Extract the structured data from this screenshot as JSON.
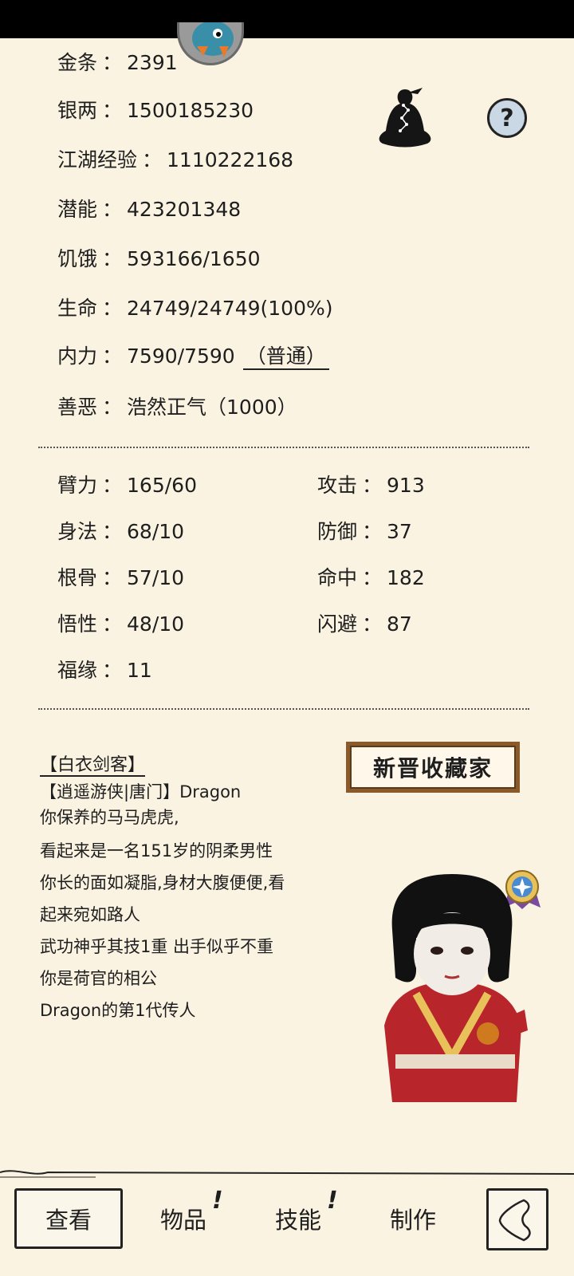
{
  "stats": {
    "gold": {
      "label": "金条",
      "value": "2391"
    },
    "silver": {
      "label": "银两",
      "value": "1500185230"
    },
    "exp": {
      "label": "江湖经验",
      "value": "1110222168"
    },
    "potential": {
      "label": "潜能",
      "value": "423201348"
    },
    "hunger": {
      "label": "饥饿",
      "value": "593166/1650"
    },
    "life": {
      "label": "生命",
      "value": "24749/24749(100%)"
    },
    "inner": {
      "label": "内力",
      "value": "7590/7590",
      "mode": "（普通）"
    },
    "morality": {
      "label": "善恶",
      "value": "浩然正气（1000）"
    },
    "separator": "："
  },
  "attributes": {
    "strength": {
      "label": "臂力",
      "value": "165/60"
    },
    "agility": {
      "label": "身法",
      "value": "68/10"
    },
    "constitution": {
      "label": "根骨",
      "value": "57/10"
    },
    "wisdom": {
      "label": "悟性",
      "value": "48/10"
    },
    "luck": {
      "label": "福缘",
      "value": "11"
    },
    "attack": {
      "label": "攻击",
      "value": "913"
    },
    "defense": {
      "label": "防御",
      "value": "37"
    },
    "hit": {
      "label": "命中",
      "value": "182"
    },
    "dodge": {
      "label": "闪避",
      "value": "87"
    }
  },
  "help": {
    "symbol": "?"
  },
  "title_badge": "新晋收藏家",
  "bio": {
    "title": "【白衣剑客】",
    "line1": "【逍遥游侠|唐门】Dragon",
    "line2": "你保养的马马虎虎,",
    "line3": "看起来是一名151岁的阴柔男性",
    "line4": "你长的面如凝脂,身材大腹便便,看",
    "line5": "起来宛如路人",
    "line6": "武功神乎其技1重 出手似乎不重",
    "line7": "你是荷官的相公",
    "line8": "Dragon的第1代传人"
  },
  "tabs": {
    "view": "查看",
    "items": "物品",
    "skills": "技能",
    "craft": "制作",
    "alert_mark": "!"
  },
  "colors": {
    "background": "#faf3e2",
    "robe": "#b8262c",
    "badge_frame": "#8b5a2b"
  }
}
